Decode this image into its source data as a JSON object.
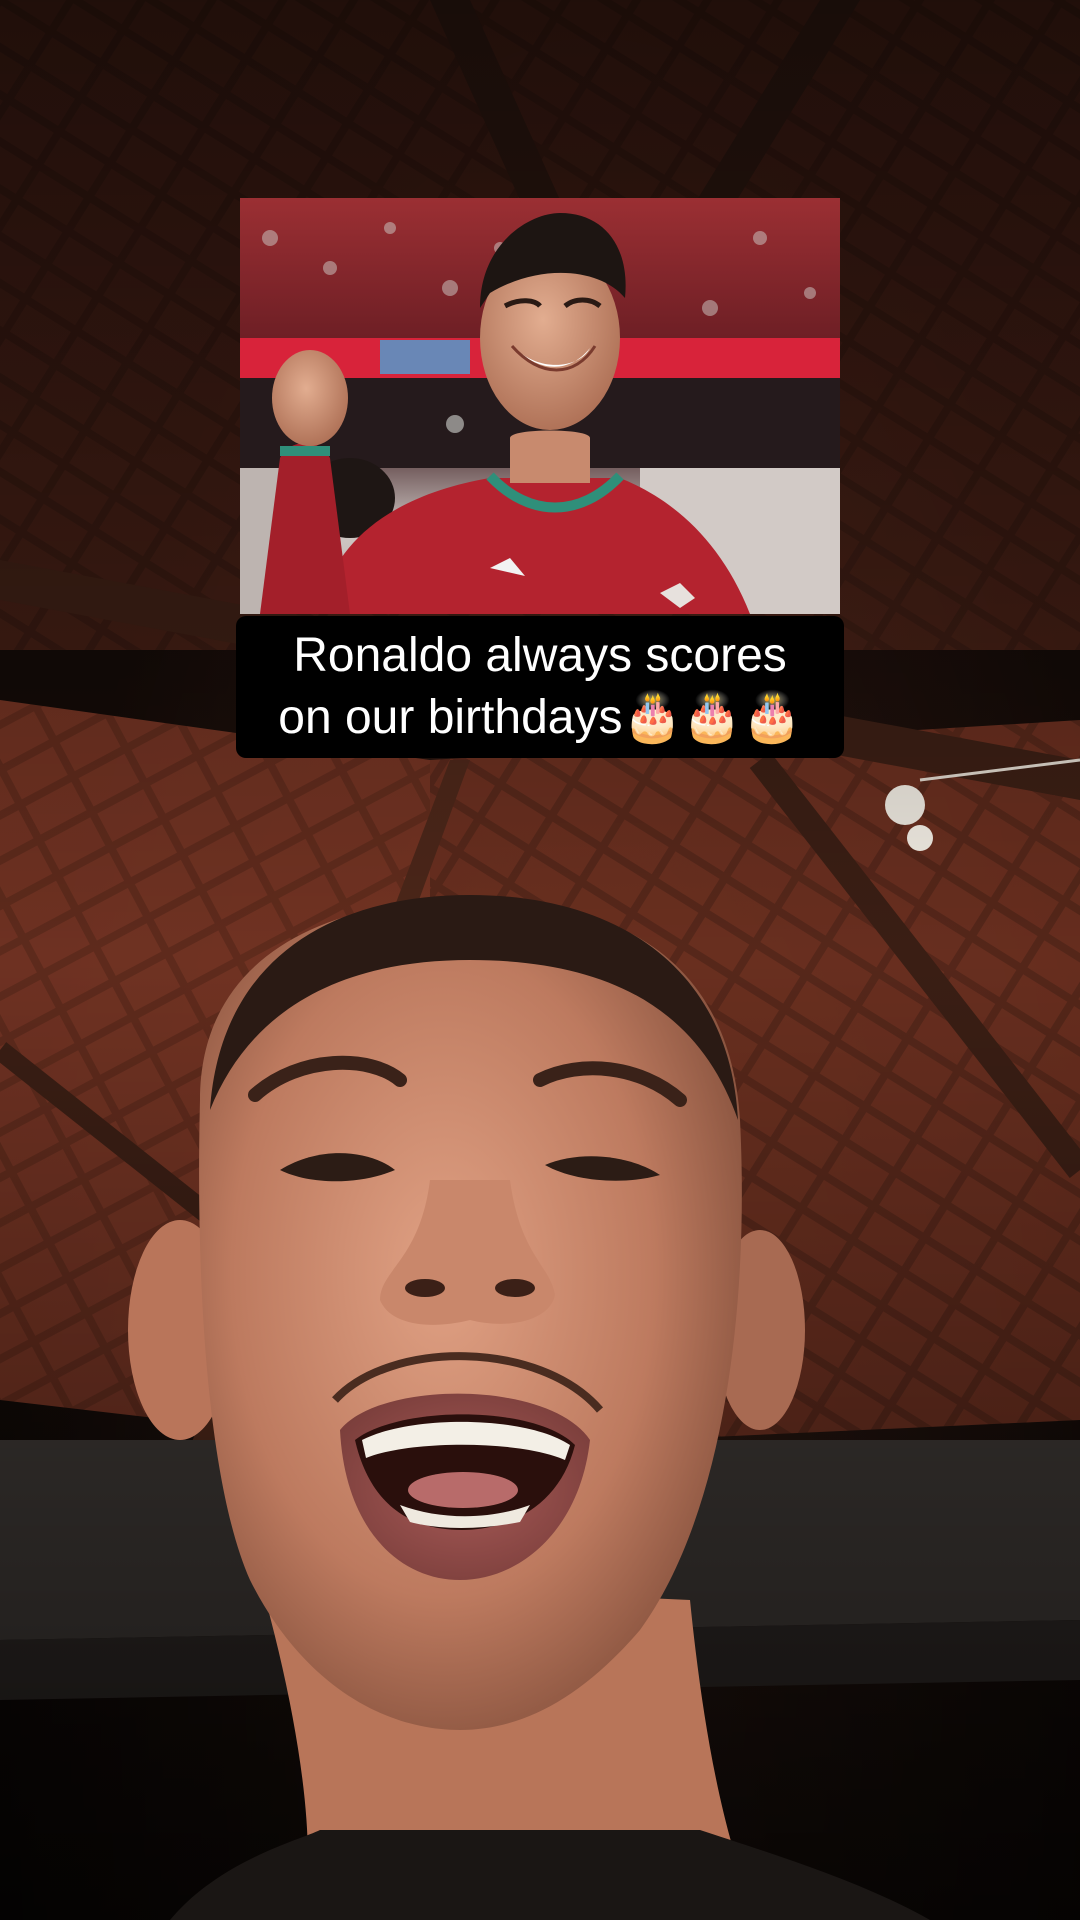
{
  "caption": {
    "text": "Ronaldo always scores\non our birthdays🎂🎂🎂"
  },
  "inset_photo": {
    "subject": "celebrating footballer in red jersey",
    "colors": {
      "jersey": "#b4232f",
      "collar": "#2f8f7a",
      "crowd": "#8c2a2e"
    }
  },
  "background": {
    "description": "wooden roof ceiling",
    "colors": {
      "wood_dark": "#2a1712",
      "wood_mid": "#5a2f20",
      "tile": "#7a3a26"
    }
  }
}
